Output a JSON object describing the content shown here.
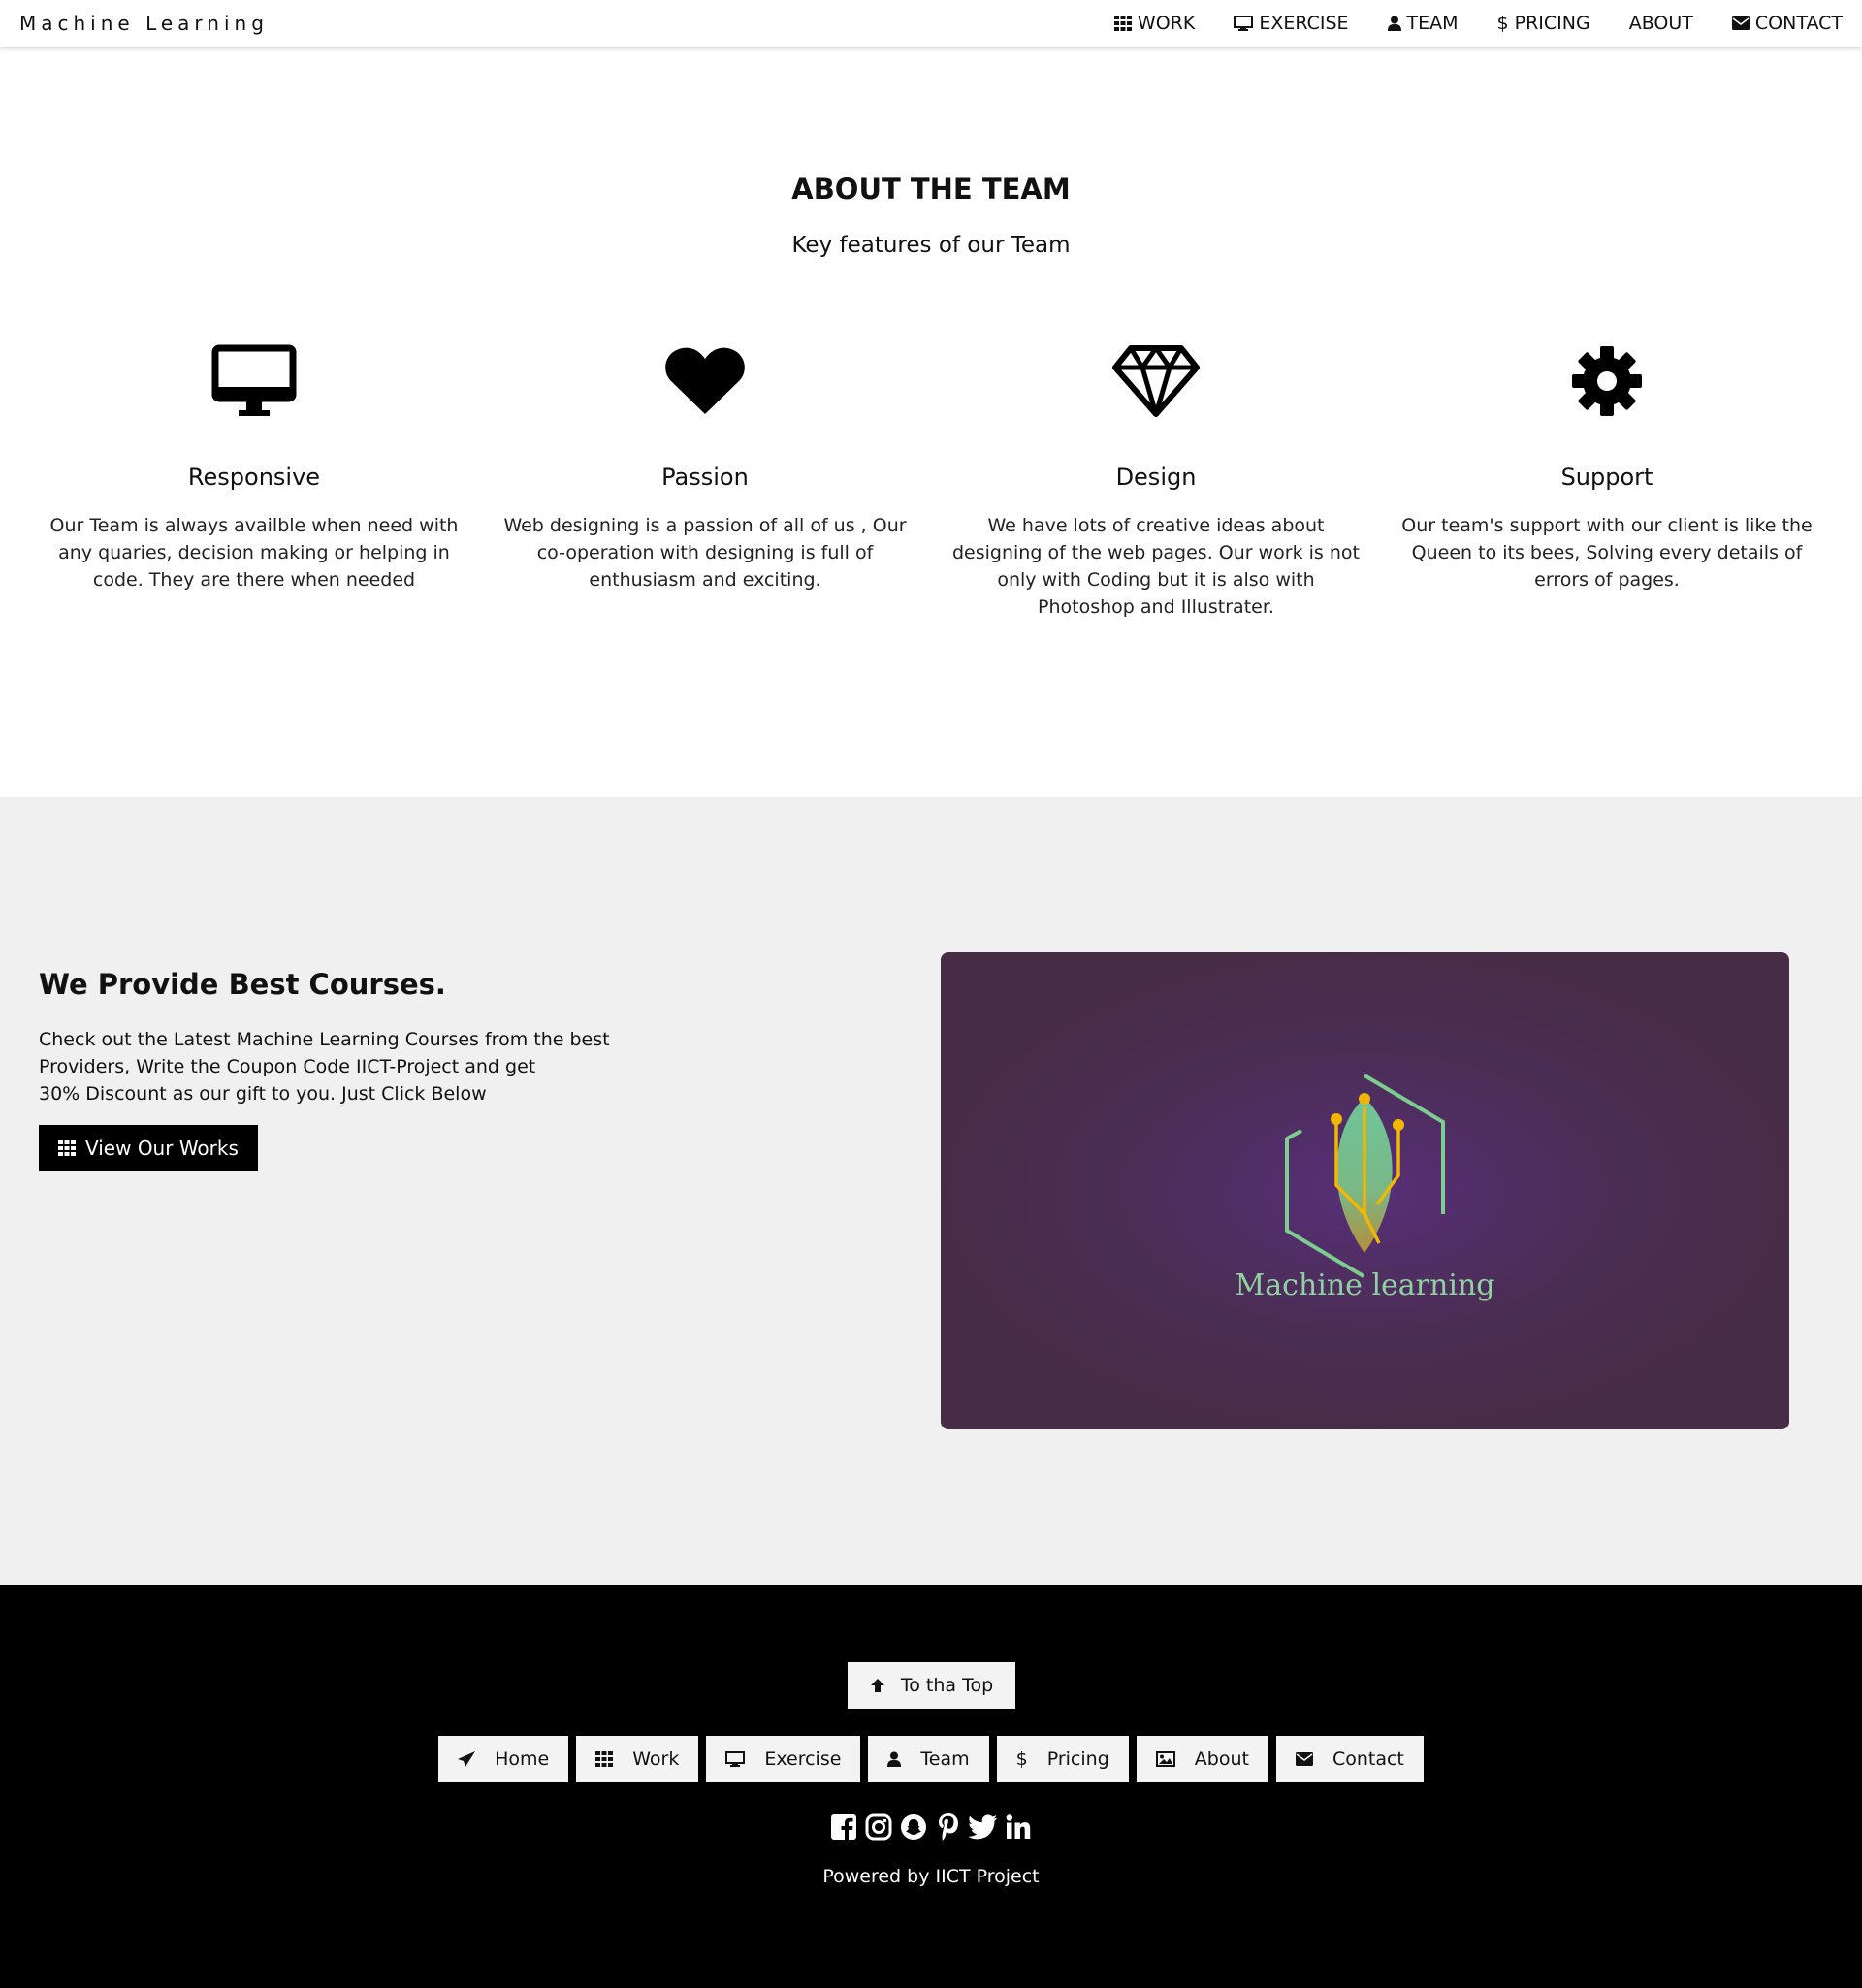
{
  "nav": {
    "brand": "Machine Learning",
    "links": [
      {
        "label": "WORK",
        "icon": "grid-icon"
      },
      {
        "label": "EXERCISE",
        "icon": "desktop-icon"
      },
      {
        "label": "TEAM",
        "icon": "user-icon"
      },
      {
        "label": "PRICING",
        "icon": "dollar-icon"
      },
      {
        "label": "ABOUT",
        "icon": ""
      },
      {
        "label": "CONTACT",
        "icon": "envelope-icon"
      }
    ]
  },
  "team": {
    "title": "ABOUT THE TEAM",
    "subtitle": "Key features of our Team",
    "features": [
      {
        "icon": "desktop-icon",
        "name": "Responsive",
        "desc": "Our Team is always availble when need with any quaries, decision making or helping in code. They are there when needed"
      },
      {
        "icon": "heart-icon",
        "name": "Passion",
        "desc": "Web designing is a passion of all of us , Our co-operation with designing is full of enthusiasm and exciting."
      },
      {
        "icon": "diamond-icon",
        "name": "Design",
        "desc": "We have lots of creative ideas about designing of the web pages. Our work is not only with Coding but it is also with Photoshop and Illustrater."
      },
      {
        "icon": "gear-icon",
        "name": "Support",
        "desc": "Our team's support with our client is like the Queen to its bees, Solving every details of errors of pages."
      }
    ]
  },
  "courses": {
    "title": "We Provide Best Courses.",
    "text_lines": [
      "Check out the Latest Machine Learning Courses from the best",
      "Providers, Write the Coupon Code IICT-Project and get",
      "30% Discount as our gift to you. Just Click Below"
    ],
    "button_label": "View Our Works",
    "image_text": "Machine learning",
    "colors": {
      "card_bg": "#4b2d55",
      "logo_green": "#8fd1a0",
      "logo_gold": "#f2b705"
    }
  },
  "footer": {
    "top_button": "To tha Top",
    "links": [
      {
        "label": "Home",
        "icon": "paper-plane-icon"
      },
      {
        "label": "Work",
        "icon": "grid-icon"
      },
      {
        "label": "Exercise",
        "icon": "desktop-icon"
      },
      {
        "label": "Team",
        "icon": "user-icon"
      },
      {
        "label": "Pricing",
        "icon": "dollar-icon"
      },
      {
        "label": "About",
        "icon": "image-icon"
      },
      {
        "label": "Contact",
        "icon": "envelope-icon"
      }
    ],
    "socials": [
      "facebook-icon",
      "instagram-icon",
      "snapchat-icon",
      "pinterest-icon",
      "twitter-icon",
      "linkedin-icon"
    ],
    "powered": "Powered by IICT Project"
  }
}
